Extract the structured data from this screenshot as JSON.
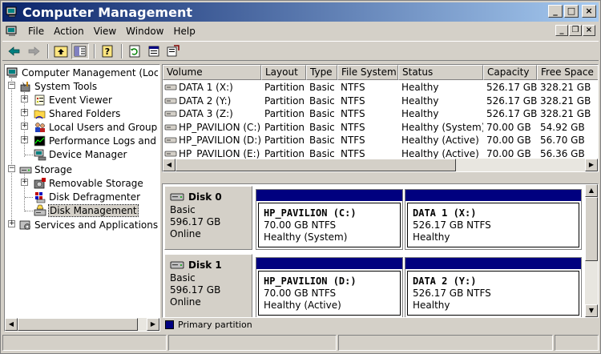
{
  "window": {
    "title": "Computer Management",
    "controls": {
      "minimize": "_",
      "maximize": "□",
      "close": "×"
    }
  },
  "menu": {
    "items": [
      "File",
      "Action",
      "View",
      "Window",
      "Help"
    ],
    "mdi_controls": {
      "minimize": "_",
      "restore": "❐",
      "close": "×"
    }
  },
  "toolbar": {
    "icons": [
      "back-arrow-icon",
      "forward-arrow-icon",
      "up-folder-icon",
      "show-hide-tree-icon",
      "help-icon",
      "refresh-icon",
      "properties-icon",
      "export-icon"
    ]
  },
  "tree": {
    "items": [
      {
        "label": "Computer Management (Local)",
        "icon": "computer-icon",
        "level": 0
      },
      {
        "label": "System Tools",
        "icon": "tools-icon",
        "level": 1,
        "expander": "−"
      },
      {
        "label": "Event Viewer",
        "icon": "event-viewer-icon",
        "level": 2,
        "expander": "+"
      },
      {
        "label": "Shared Folders",
        "icon": "shared-folder-icon",
        "level": 2,
        "expander": "+"
      },
      {
        "label": "Local Users and Groups",
        "icon": "users-icon",
        "level": 2,
        "expander": "+"
      },
      {
        "label": "Performance Logs and Alerts",
        "icon": "performance-icon",
        "level": 2,
        "expander": "+"
      },
      {
        "label": "Device Manager",
        "icon": "device-manager-icon",
        "level": 2
      },
      {
        "label": "Storage",
        "icon": "storage-icon",
        "level": 1,
        "expander": "−"
      },
      {
        "label": "Removable Storage",
        "icon": "removable-storage-icon",
        "level": 2,
        "expander": "+"
      },
      {
        "label": "Disk Defragmenter",
        "icon": "defrag-icon",
        "level": 2
      },
      {
        "label": "Disk Management",
        "icon": "disk-management-icon",
        "level": 2,
        "selected": true
      },
      {
        "label": "Services and Applications",
        "icon": "services-icon",
        "level": 1,
        "expander": "+"
      }
    ]
  },
  "volumes": {
    "columns": [
      "Volume",
      "Layout",
      "Type",
      "File System",
      "Status",
      "Capacity",
      "Free Space"
    ],
    "rows": [
      [
        "DATA 1 (X:)",
        "Partition",
        "Basic",
        "NTFS",
        "Healthy",
        "526.17 GB",
        "328.21 GB"
      ],
      [
        "DATA 2 (Y:)",
        "Partition",
        "Basic",
        "NTFS",
        "Healthy",
        "526.17 GB",
        "328.21 GB"
      ],
      [
        "DATA 3 (Z:)",
        "Partition",
        "Basic",
        "NTFS",
        "Healthy",
        "526.17 GB",
        "328.21 GB"
      ],
      [
        "HP_PAVILION (C:)",
        "Partition",
        "Basic",
        "NTFS",
        "Healthy (System)",
        "70.00 GB",
        "54.92 GB"
      ],
      [
        "HP_PAVILION (D:)",
        "Partition",
        "Basic",
        "NTFS",
        "Healthy (Active)",
        "70.00 GB",
        "56.70 GB"
      ],
      [
        "HP_PAVILION (E:)",
        "Partition",
        "Basic",
        "NTFS",
        "Healthy (Active)",
        "70.00 GB",
        "56.36 GB"
      ]
    ]
  },
  "disks": [
    {
      "name": "Disk 0",
      "kind": "Basic",
      "size": "596.17 GB",
      "state": "Online",
      "partitions": [
        {
          "name": "HP_PAVILION  (C:)",
          "size": "70.00 GB NTFS",
          "status": "Healthy (System)"
        },
        {
          "name": "DATA 1  (X:)",
          "size": "526.17 GB NTFS",
          "status": "Healthy"
        }
      ]
    },
    {
      "name": "Disk 1",
      "kind": "Basic",
      "size": "596.17 GB",
      "state": "Online",
      "partitions": [
        {
          "name": "HP_PAVILION  (D:)",
          "size": "70.00 GB NTFS",
          "status": "Healthy (Active)"
        },
        {
          "name": "DATA 2  (Y:)",
          "size": "526.17 GB NTFS",
          "status": "Healthy"
        }
      ]
    }
  ],
  "legend": {
    "label": "Primary partition",
    "color": "#00007f"
  },
  "colors": {
    "title_start": "#0a246a",
    "title_end": "#a6caf0",
    "partition_bar": "#00007f",
    "chrome": "#d4d0c8"
  }
}
